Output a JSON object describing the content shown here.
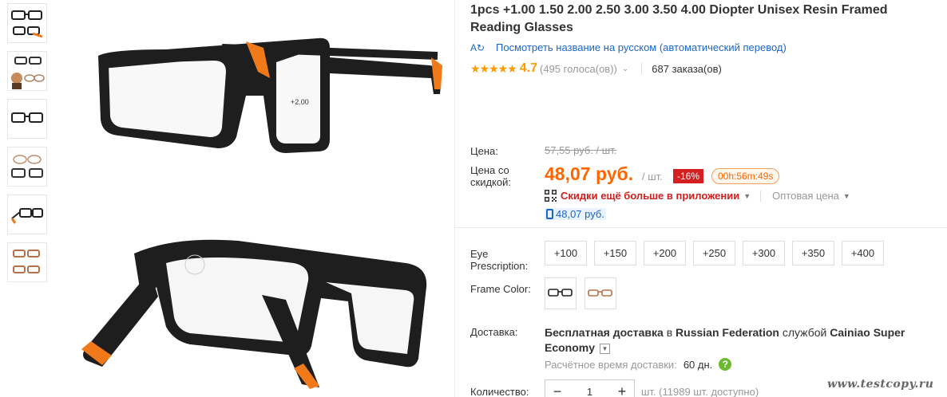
{
  "product": {
    "title": "1pcs +1.00 1.50 2.00 2.50 3.00 3.50 4.00 Diopter Unisex Resin Framed Reading Glasses",
    "translate_link": "Посмотреть название на русском (автоматический перевод)",
    "translate_icon": "A↻",
    "rating_stars": "★★★★★",
    "rating_value": "4.7",
    "votes": "(495 голоса(ов))",
    "votes_chevron": "⌄",
    "orders": "687 заказа(ов)",
    "lens_label": "+2.00"
  },
  "price": {
    "label": "Цена:",
    "old_price": "57,55 руб. / шт.",
    "discount_label": "Цена со скидкой:",
    "new_price": "48,07 руб.",
    "per_unit": "/ шт.",
    "discount": "-16%",
    "timer": "00h:56m:49s",
    "app_deal": "Скидки ещё больше в приложении",
    "wholesale": "Оптовая цена",
    "mobile_price": "48,07 руб."
  },
  "options": {
    "eye_label": "Eye Prescription:",
    "eye_values": [
      "+100",
      "+150",
      "+200",
      "+250",
      "+300",
      "+350",
      "+400"
    ],
    "color_label": "Frame Color:"
  },
  "delivery": {
    "label": "Доставка:",
    "text_bold1": "Бесплатная доставка",
    "text_mid": " в ",
    "text_bold2": "Russian Federation",
    "text_mid2": " службой ",
    "text_bold3": "Cainiao Super Economy",
    "eta_label": "Расчётное время доставки:",
    "eta_value": "60 дн.",
    "help": "?"
  },
  "quantity": {
    "label": "Количество:",
    "minus": "−",
    "value": "1",
    "plus": "+",
    "stock": "шт. (11989 шт. доступно)"
  },
  "watermark": "www.testcopy.ru",
  "colors": {
    "accent": "#ff6600",
    "link": "#1a66c9",
    "discount": "#d31f1f",
    "star": "#ff9a00"
  }
}
